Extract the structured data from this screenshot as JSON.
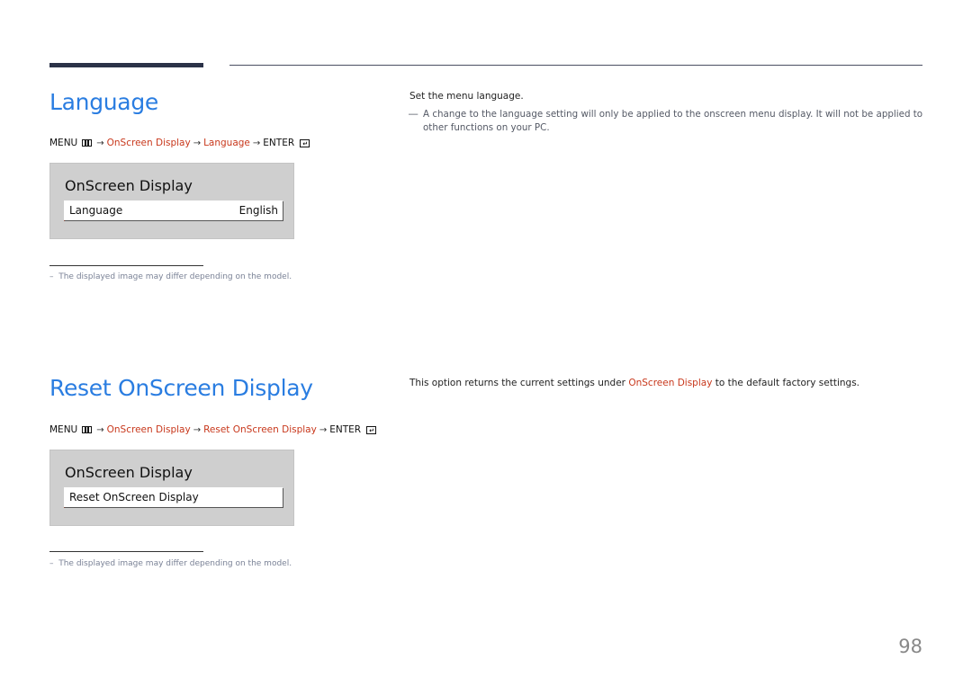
{
  "page_number": "98",
  "sections": [
    {
      "title": "Language",
      "path": {
        "menu": "MENU",
        "step1": "OnScreen Display",
        "step2": "Language",
        "enter": "ENTER"
      },
      "osd": {
        "title": "OnScreen Display",
        "row_label": "Language",
        "row_value": "English"
      },
      "footnote": "The displayed image may differ depending on the model.",
      "description": "Set the menu language.",
      "note_line1": "A change to the language setting will only be applied to the onscreen menu display. It will not be applied to",
      "note_line2": "other functions on your PC."
    },
    {
      "title": "Reset OnScreen Display",
      "path": {
        "menu": "MENU",
        "step1": "OnScreen Display",
        "step2": "Reset OnScreen Display",
        "enter": "ENTER"
      },
      "osd": {
        "title": "OnScreen Display",
        "row_label": "Reset OnScreen Display"
      },
      "footnote": "The displayed image may differ depending on the model.",
      "description_pre": "This option returns the current settings under ",
      "description_link": "OnScreen Display",
      "description_post": " to the default factory settings."
    }
  ],
  "symbols": {
    "arrow": "→",
    "dash": "–",
    "note_mark": "―"
  },
  "colors": {
    "heading": "#2a7de1",
    "highlight": "#c8381c",
    "osd_bg": "#cfcfcf"
  }
}
